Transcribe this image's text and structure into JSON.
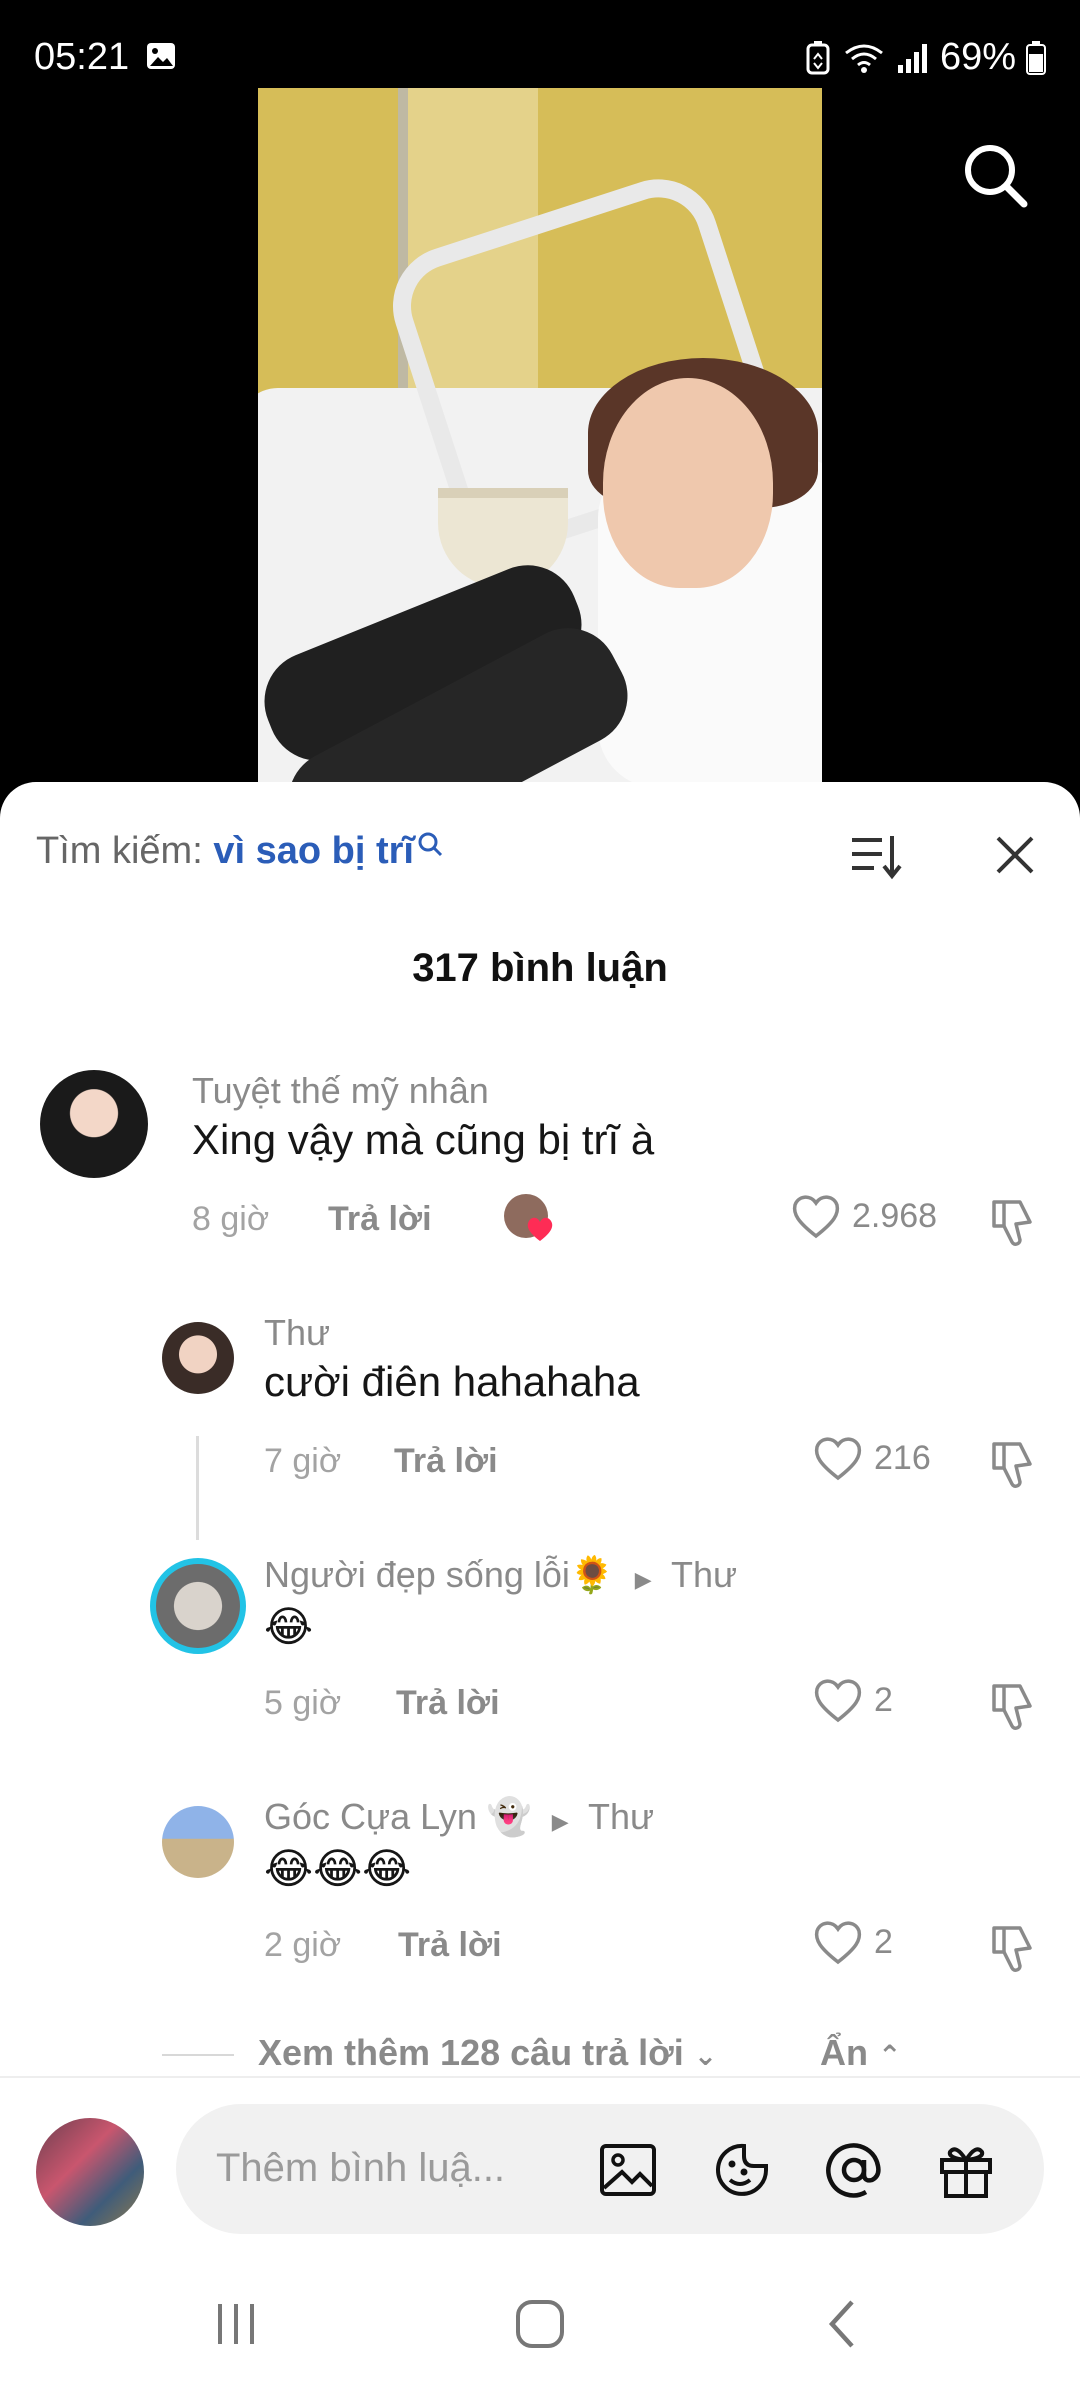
{
  "status_bar": {
    "time": "05:21",
    "battery": "69%"
  },
  "search_bar": {
    "label": "Tìm kiếm:",
    "query": "vì sao bị trĩ"
  },
  "comments_count": "317 bình luận",
  "comments": [
    {
      "user": "Tuyệt thế mỹ nhân",
      "text": "Xing vậy mà cũng bị trĩ à",
      "time": "8 giờ",
      "reply": "Trả lời",
      "likes": "2.968"
    },
    {
      "user": "Thư",
      "text": "cười điên hahahaha",
      "time": "7 giờ",
      "reply": "Trả lời",
      "likes": "216"
    },
    {
      "user": "Người đẹp sống lỗi🌻",
      "reply_to": "Thư",
      "text": "😂",
      "time": "5 giờ",
      "reply": "Trả lời",
      "likes": "2"
    },
    {
      "user": "Góc Cựa Lyn 👻",
      "reply_to": "Thư",
      "text": "😂😂😂",
      "time": "2 giờ",
      "reply": "Trả lời",
      "likes": "2"
    }
  ],
  "more_replies": {
    "label": "Xem thêm 128 câu trả lời",
    "hide_label": "Ẩn"
  },
  "composer": {
    "placeholder": "Thêm bình luậ..."
  },
  "colors": {
    "accent": "#2b5db8",
    "heart_badge": "#fe2c55"
  },
  "icons": [
    "search-icon",
    "sort-icon",
    "close-icon",
    "heart-icon",
    "dislike-icon",
    "image-icon",
    "emoji-icon",
    "mention-icon",
    "gift-icon"
  ]
}
